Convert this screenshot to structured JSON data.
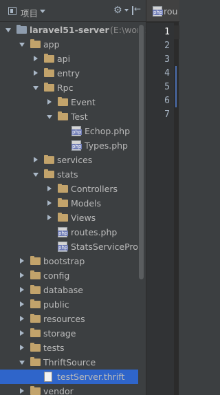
{
  "panel": {
    "view_label": "项目"
  },
  "editor": {
    "tab_label": "rou",
    "line_numbers": [
      "1",
      "2",
      "3",
      "4",
      "5",
      "6",
      "7"
    ]
  },
  "tree": [
    {
      "label": "laravel51-server",
      "sub": "(E:\\works",
      "depth": 0,
      "type": "root-folder",
      "state": "open"
    },
    {
      "label": "app",
      "depth": 1,
      "type": "folder",
      "state": "open"
    },
    {
      "label": "api",
      "depth": 2,
      "type": "folder",
      "state": "closed"
    },
    {
      "label": "entry",
      "depth": 2,
      "type": "folder",
      "state": "closed"
    },
    {
      "label": "Rpc",
      "depth": 2,
      "type": "folder",
      "state": "open"
    },
    {
      "label": "Event",
      "depth": 3,
      "type": "folder",
      "state": "closed"
    },
    {
      "label": "Test",
      "depth": 3,
      "type": "folder",
      "state": "open"
    },
    {
      "label": "Echop.php",
      "depth": 4,
      "type": "php"
    },
    {
      "label": "Types.php",
      "depth": 4,
      "type": "php"
    },
    {
      "label": "services",
      "depth": 2,
      "type": "folder",
      "state": "closed"
    },
    {
      "label": "stats",
      "depth": 2,
      "type": "folder",
      "state": "open"
    },
    {
      "label": "Controllers",
      "depth": 3,
      "type": "folder",
      "state": "closed"
    },
    {
      "label": "Models",
      "depth": 3,
      "type": "folder",
      "state": "closed"
    },
    {
      "label": "Views",
      "depth": 3,
      "type": "folder",
      "state": "closed"
    },
    {
      "label": "routes.php",
      "depth": 3,
      "type": "php"
    },
    {
      "label": "StatsServiceProv",
      "depth": 3,
      "type": "php"
    },
    {
      "label": "bootstrap",
      "depth": 1,
      "type": "folder",
      "state": "closed"
    },
    {
      "label": "config",
      "depth": 1,
      "type": "folder",
      "state": "closed"
    },
    {
      "label": "database",
      "depth": 1,
      "type": "folder",
      "state": "closed"
    },
    {
      "label": "public",
      "depth": 1,
      "type": "folder",
      "state": "closed"
    },
    {
      "label": "resources",
      "depth": 1,
      "type": "folder",
      "state": "closed"
    },
    {
      "label": "storage",
      "depth": 1,
      "type": "folder",
      "state": "closed"
    },
    {
      "label": "tests",
      "depth": 1,
      "type": "folder",
      "state": "closed"
    },
    {
      "label": "ThriftSource",
      "depth": 1,
      "type": "folder",
      "state": "open"
    },
    {
      "label": "testServer.thrift",
      "depth": 2,
      "type": "thrift",
      "selected": true
    },
    {
      "label": "vendor",
      "depth": 1,
      "type": "folder",
      "state": "closed"
    }
  ]
}
